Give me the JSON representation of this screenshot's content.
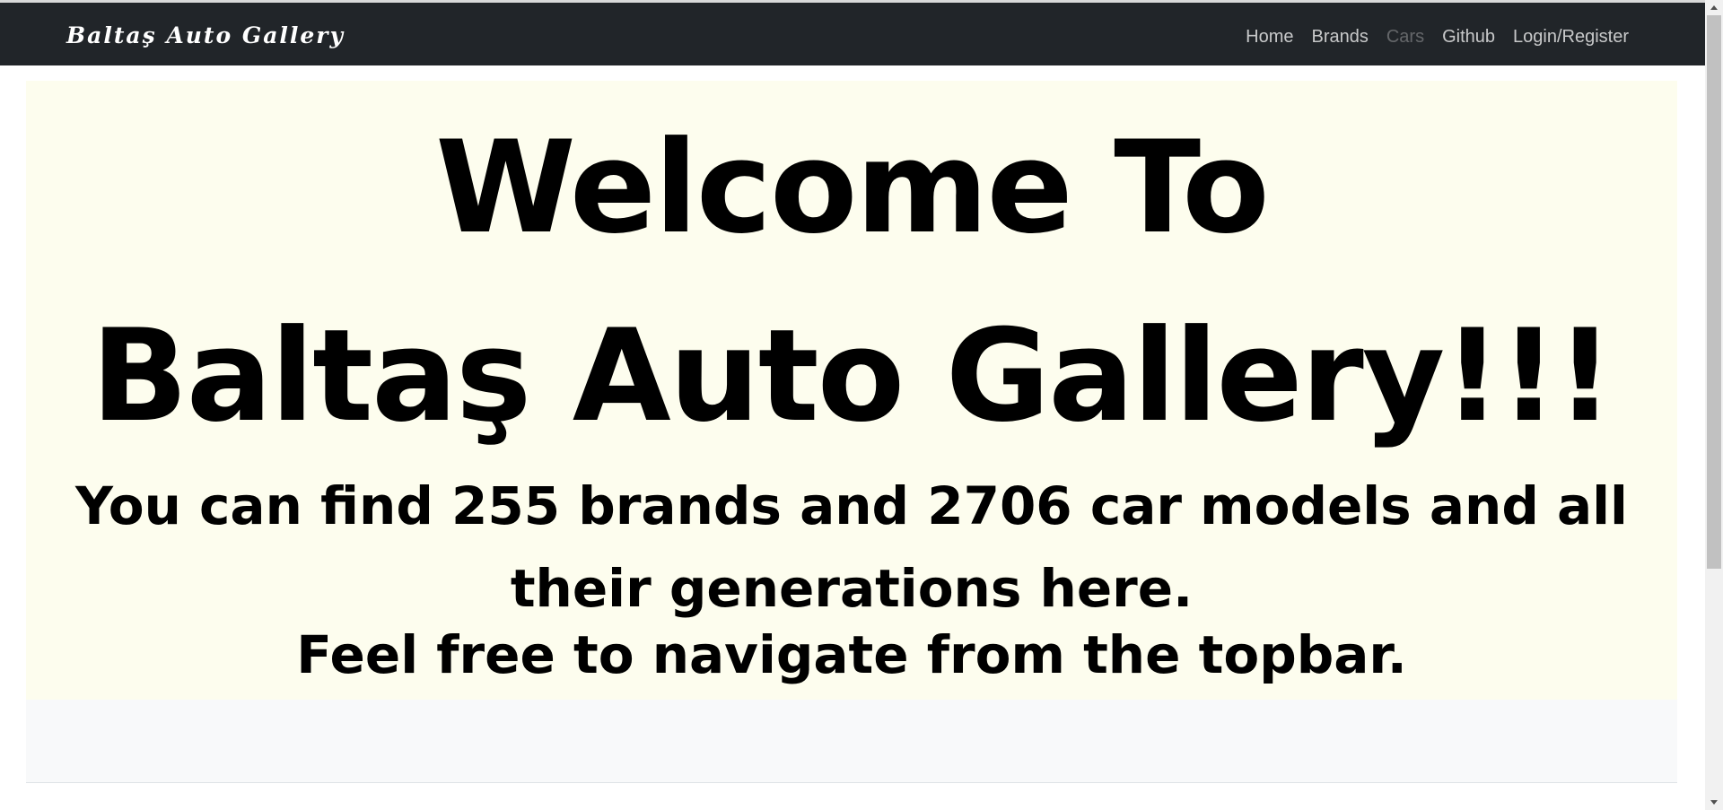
{
  "navbar": {
    "brand": "Baltaş Auto Gallery",
    "links": [
      {
        "label": "Home",
        "disabled": false
      },
      {
        "label": "Brands",
        "disabled": false
      },
      {
        "label": "Cars",
        "disabled": true
      },
      {
        "label": "Github",
        "disabled": false
      },
      {
        "label": "Login/Register",
        "disabled": false
      }
    ]
  },
  "hero": {
    "line1": "Welcome To",
    "line2": "Baltaş Auto Gallery!!!",
    "subtitle": "You can find 255 brands and 2706 car models and all their generations here.",
    "subtitle2": "Feel free to navigate from the topbar."
  },
  "colors": {
    "navbar_bg": "#212529",
    "hero_bg": "#fdfdee",
    "footer_bg": "#f8f9fa"
  },
  "icons": {
    "scroll_up": "scroll-up-arrow-icon",
    "scroll_down": "scroll-down-arrow-icon"
  }
}
